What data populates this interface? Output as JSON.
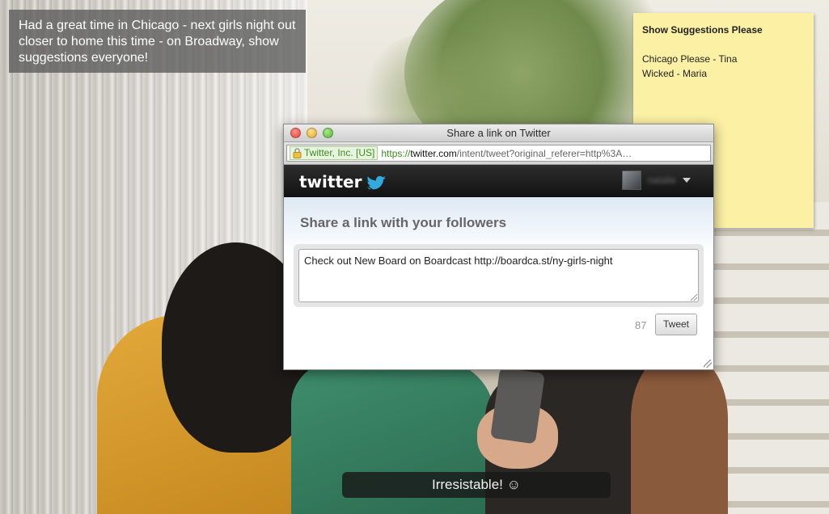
{
  "background": {
    "description_icon": "photo-backdrop"
  },
  "caption": {
    "text": "Had a great time in Chicago - next girls night out closer to home this time - on Broadway, show suggestions everyone!"
  },
  "sticky_note": {
    "title": "Show Suggestions Please",
    "lines": [
      "Chicago Please - Tina",
      "Wicked - Maria"
    ]
  },
  "window": {
    "title": "Share a link on Twitter",
    "url": {
      "identity": "Twitter, Inc. [US]",
      "scheme": "https://",
      "host": "twitter.com",
      "path": "/intent/tweet?original_referer=http%3A…"
    },
    "twitter": {
      "logo_text": "twitter",
      "username": "natalie",
      "heading": "Share a link with your followers",
      "tweet_text": "Check out New Board on Boardcast http://boardca.st/ny-girls-night",
      "char_count": "87",
      "tweet_button": "Tweet"
    }
  },
  "bottom_caption": {
    "text": "Irresistable! ☺"
  },
  "colors": {
    "sticky": "#fbf0a4",
    "twitter_blue": "#33aadd",
    "secure_green": "#3c8d1e"
  }
}
